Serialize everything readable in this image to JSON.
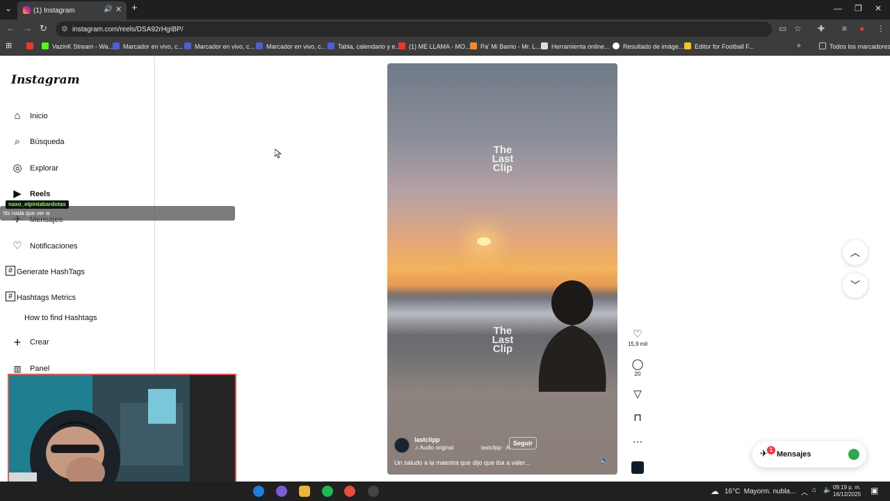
{
  "browser": {
    "tab_title": "(1) Instagram",
    "url": "instagram.com/reels/DSA92rHgIBP/",
    "bookmarks": [
      "VazinK Stream - Wa...",
      "Marcador en vivo, c...",
      "Marcador en vivo, c...",
      "Marcador en vivo, c...",
      "Tabla, calendario y e...",
      "(1) ME LLAMA - MO...",
      "Pa' Mi Barrio - Mr. L...",
      "Herramienta online...",
      "Resultado de imáge...",
      "Editor for Football F...",
      "Todos los marcadores"
    ]
  },
  "sidebar": {
    "logo": "Instagram",
    "items": [
      {
        "label": "Inicio",
        "icon": "home-icon"
      },
      {
        "label": "Búsqueda",
        "icon": "search-icon"
      },
      {
        "label": "Explorar",
        "icon": "compass-icon"
      },
      {
        "label": "Reels",
        "icon": "reels-icon"
      },
      {
        "label": "Mensajes",
        "icon": "messenger-icon"
      },
      {
        "label": "Notificaciones",
        "icon": "heart-icon"
      },
      {
        "label": "Generate HashTags",
        "icon": "hashtag-icon"
      },
      {
        "label": "Hashtags Metrics",
        "icon": "hashtag-icon"
      },
      {
        "label": "How to find Hashtags",
        "icon": ""
      },
      {
        "label": "Crear",
        "icon": "plus-icon"
      },
      {
        "label": "Panel",
        "icon": "chart-icon"
      }
    ]
  },
  "overlay": {
    "chat_user": "naxo_elpintabardotas",
    "chat_text": "!tts nada que ver w"
  },
  "reel": {
    "watermark": "The Last Clip",
    "username": "lastclipp",
    "audio": "Audio original",
    "audio_author": "lastclipp · A",
    "follow": "Seguir",
    "caption": "Un saludo a la maestra que dijo que iba a valer...",
    "likes": "15,9 mil",
    "comments": "20"
  },
  "messages": {
    "label": "Mensajes",
    "badge": "1"
  },
  "taskbar": {
    "weather_temp": "16°C",
    "weather_text": "Mayorm. nubla...",
    "time": "09:19 p. m.",
    "date": "16/12/2025"
  },
  "colors": {
    "accent_red": "#ff3040",
    "ig_text": "#111111",
    "border": "#dbdbdb"
  }
}
